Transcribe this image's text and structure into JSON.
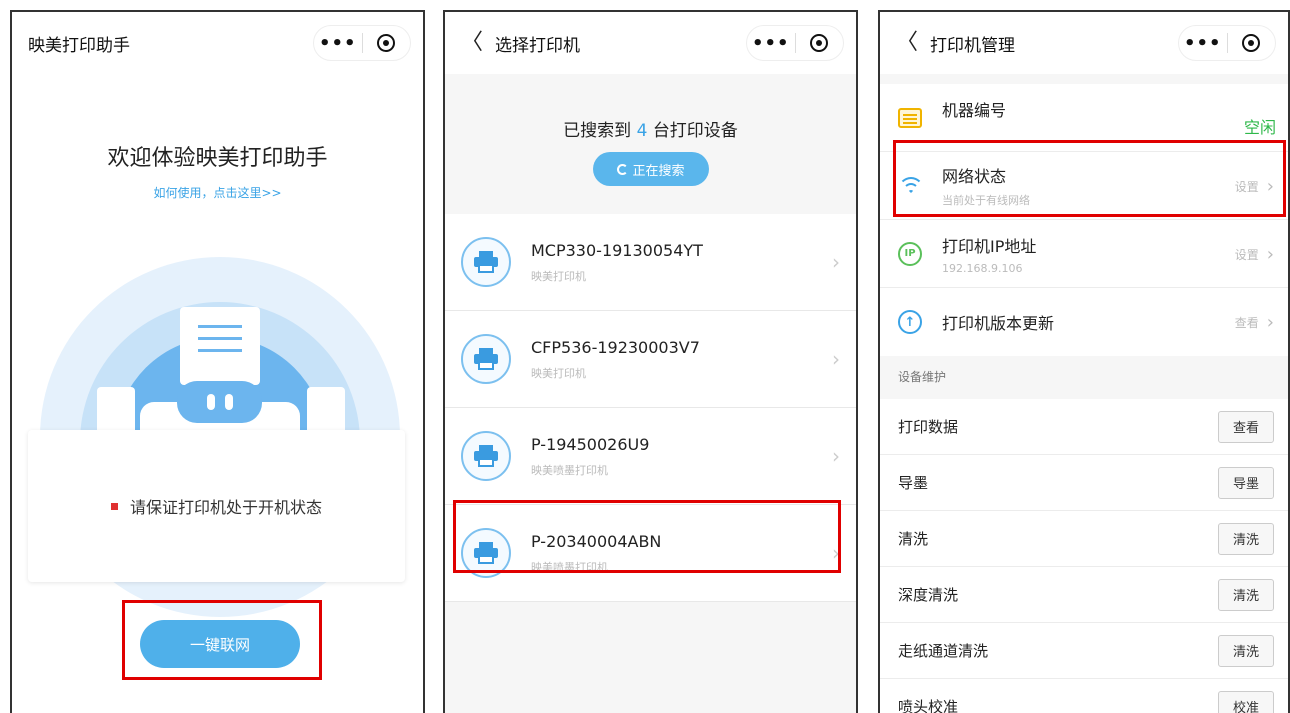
{
  "common": {
    "more_glyph": "•••"
  },
  "panel1": {
    "nav_title": "映美打印助手",
    "welcome_title": "欢迎体验映美打印助手",
    "howto_link": "如何使用，点击这里>>",
    "notice": "请保证打印机处于开机状态",
    "connect_button": "一键联网",
    "colors": {
      "accent": "#4fb0ea",
      "notice_dot": "#e03030"
    }
  },
  "panel2": {
    "nav_back": "〈",
    "nav_title": "选择打印机",
    "found_prefix": "已搜索到",
    "found_count": "4",
    "found_suffix": "台打印设备",
    "searching_button": "正在搜索",
    "devices": [
      {
        "name": "MCP330-19130054YT",
        "type": "映美打印机"
      },
      {
        "name": "CFP536-19230003V7",
        "type": "映美打印机"
      },
      {
        "name": "P-19450026U9",
        "type": "映美喷墨打印机"
      },
      {
        "name": "P-20340004ABN",
        "type": "映美喷墨打印机"
      }
    ],
    "chevron": "›"
  },
  "panel3": {
    "nav_back": "〈",
    "nav_title": "打印机管理",
    "settings": [
      {
        "icon": "device-list-icon",
        "title": "机器编号",
        "sub": "",
        "right": "空闲"
      },
      {
        "icon": "wifi-icon",
        "title": "网络状态",
        "sub": "当前处于有线网络",
        "right": "设置"
      },
      {
        "icon": "ip-icon",
        "title": "打印机IP地址",
        "sub": "192.168.9.106",
        "right": "设置"
      },
      {
        "icon": "upload-arrow-icon",
        "title": "打印机版本更新",
        "sub": "",
        "right": "查看"
      }
    ],
    "ip_glyph": "IP",
    "up_glyph": "↑",
    "chevron": "›",
    "section_label": "设备维护",
    "maintenance": [
      {
        "label": "打印数据",
        "button": "查看"
      },
      {
        "label": "导墨",
        "button": "导墨"
      },
      {
        "label": "清洗",
        "button": "清洗"
      },
      {
        "label": "深度清洗",
        "button": "清洗"
      },
      {
        "label": "走纸通道清洗",
        "button": "清洗"
      },
      {
        "label": "喷头校准",
        "button": "校准"
      }
    ],
    "colors": {
      "idle_status": "#2fb84a"
    }
  }
}
